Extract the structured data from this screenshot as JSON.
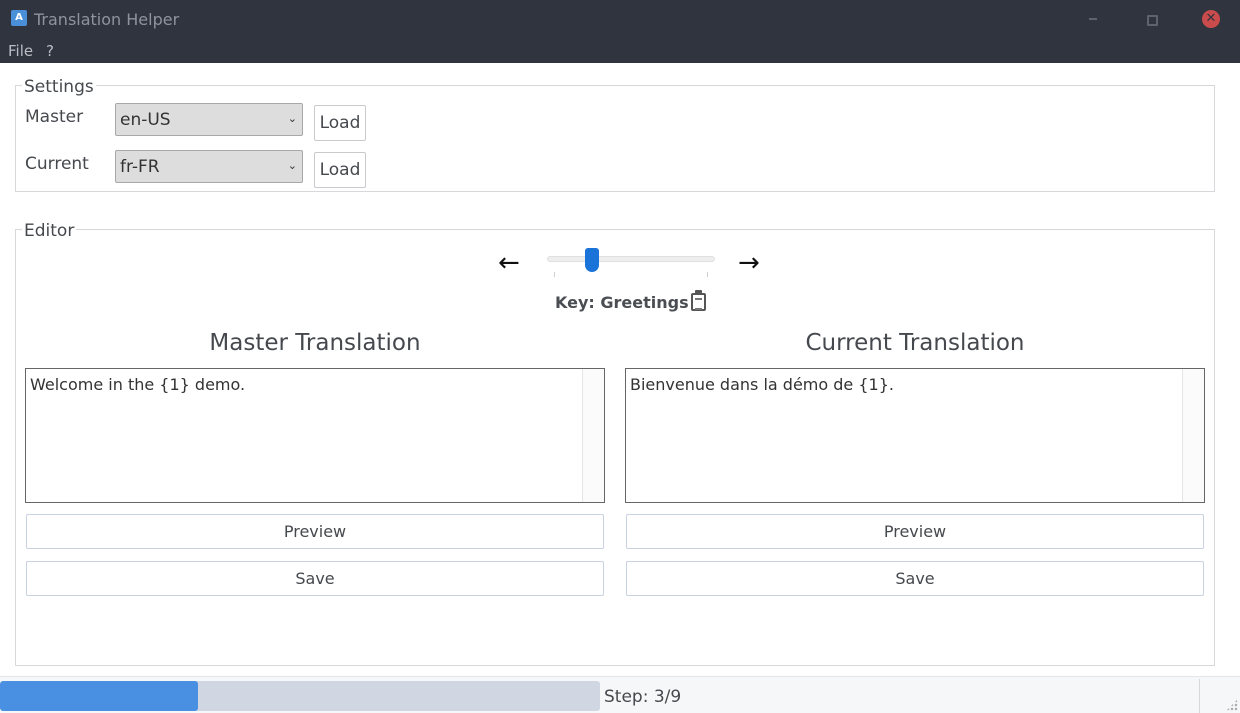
{
  "window": {
    "title": "Translation Helper",
    "app_icon_glyph": "A",
    "close_glyph": "✕"
  },
  "menu": {
    "items": [
      "File",
      "?"
    ]
  },
  "settings": {
    "title": "Settings",
    "master_label": "Master",
    "master_value": "en-US",
    "current_label": "Current",
    "current_value": "fr-FR",
    "load_label": "Load",
    "dropdown_glyph": "⌄"
  },
  "editor": {
    "title": "Editor",
    "prev_arrow": "←",
    "next_arrow": "→",
    "slider_value": 3,
    "slider_max": 9,
    "key_text": "Key: Greetings",
    "master": {
      "title": "Master Translation",
      "text": "Welcome in the {1} demo.",
      "preview_label": "Preview",
      "save_label": "Save"
    },
    "current": {
      "title": "Current Translation",
      "text": "Bienvenue dans la démo de {1}.",
      "preview_label": "Preview",
      "save_label": "Save"
    }
  },
  "status": {
    "step_text": "Step: 3/9",
    "progress_fraction": 0.33,
    "progress_color": "#4a90e2"
  },
  "colors": {
    "titlebar": "#2f343f",
    "accent": "#1a73d9"
  }
}
